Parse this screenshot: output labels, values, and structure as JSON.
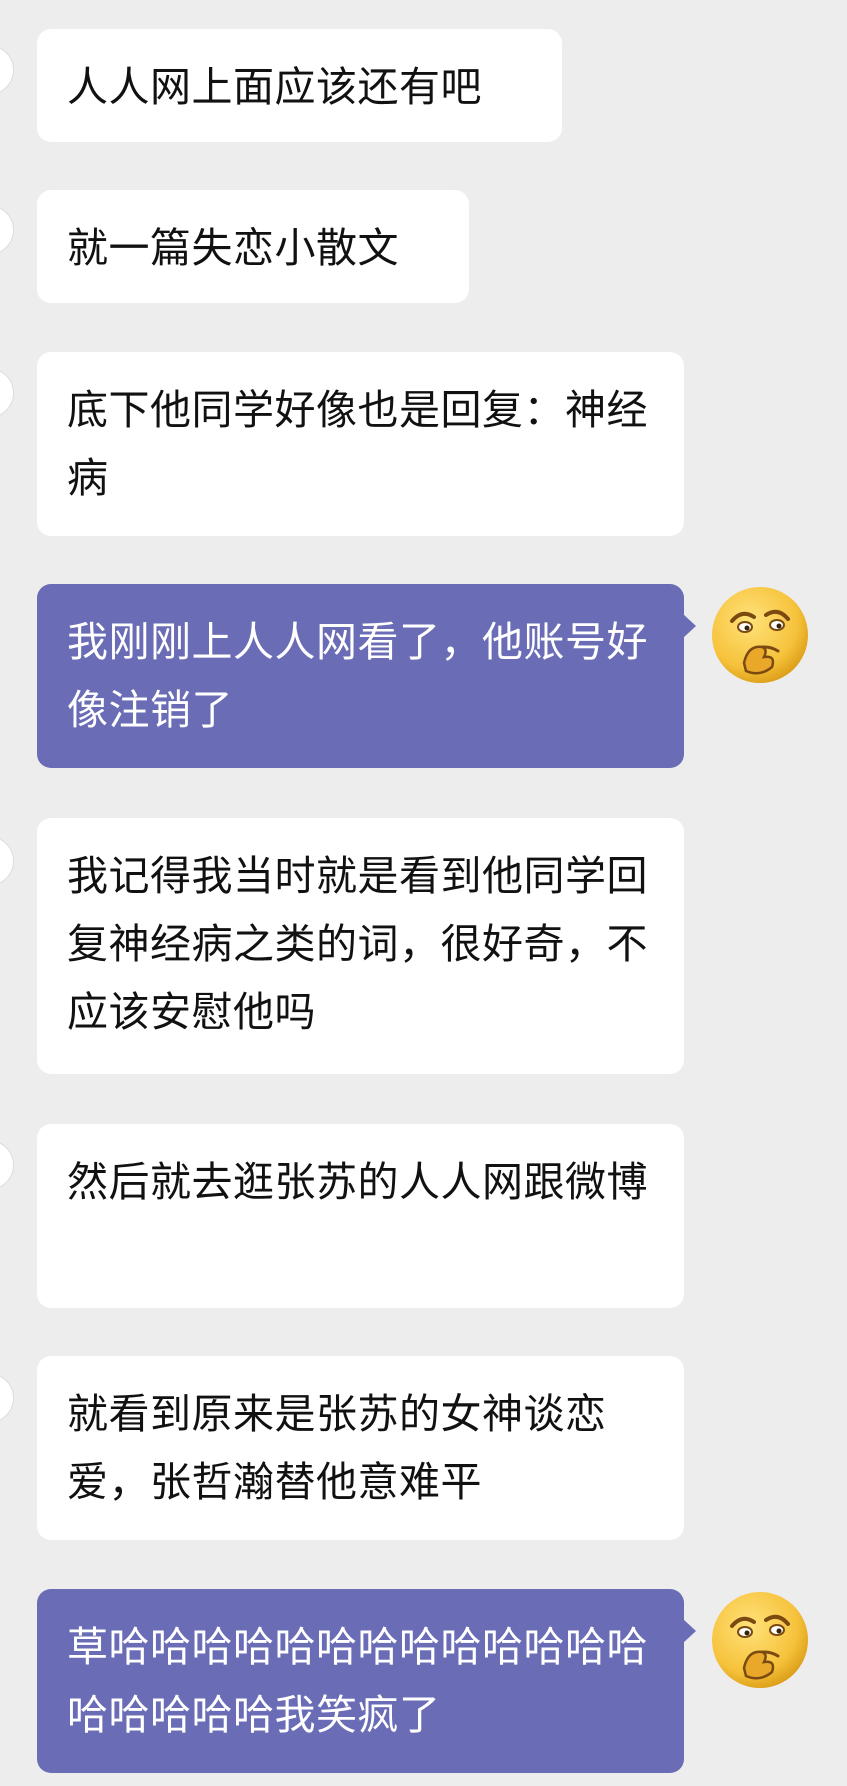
{
  "colors": {
    "background": "#ededed",
    "incoming_bubble": "#ffffff",
    "outgoing_bubble": "#6a6cb6",
    "incoming_text": "#111111",
    "outgoing_text": "#ffffff"
  },
  "messages": [
    {
      "side": "incoming",
      "text": "人人网上面应该还有吧"
    },
    {
      "side": "incoming",
      "text": "就一篇失恋小散文"
    },
    {
      "side": "incoming",
      "text": "底下他同学好像也是回复：神经病"
    },
    {
      "side": "outgoing",
      "text": "我刚刚上人人网看了，他账号好像注销了",
      "avatar_icon": "thinking-face-emoji-icon"
    },
    {
      "side": "incoming",
      "text": "我记得我当时就是看到他同学回复神经病之类的词，很好奇，不应该安慰他吗"
    },
    {
      "side": "incoming",
      "text": "然后就去逛张苏的人人网跟微博"
    },
    {
      "side": "incoming",
      "text": "就看到原来是张苏的女神谈恋爱，张哲瀚替他意难平"
    },
    {
      "side": "outgoing",
      "text": "草哈哈哈哈哈哈哈哈哈哈哈哈哈哈哈哈哈哈我笑疯了",
      "avatar_icon": "thinking-face-emoji-icon"
    }
  ]
}
